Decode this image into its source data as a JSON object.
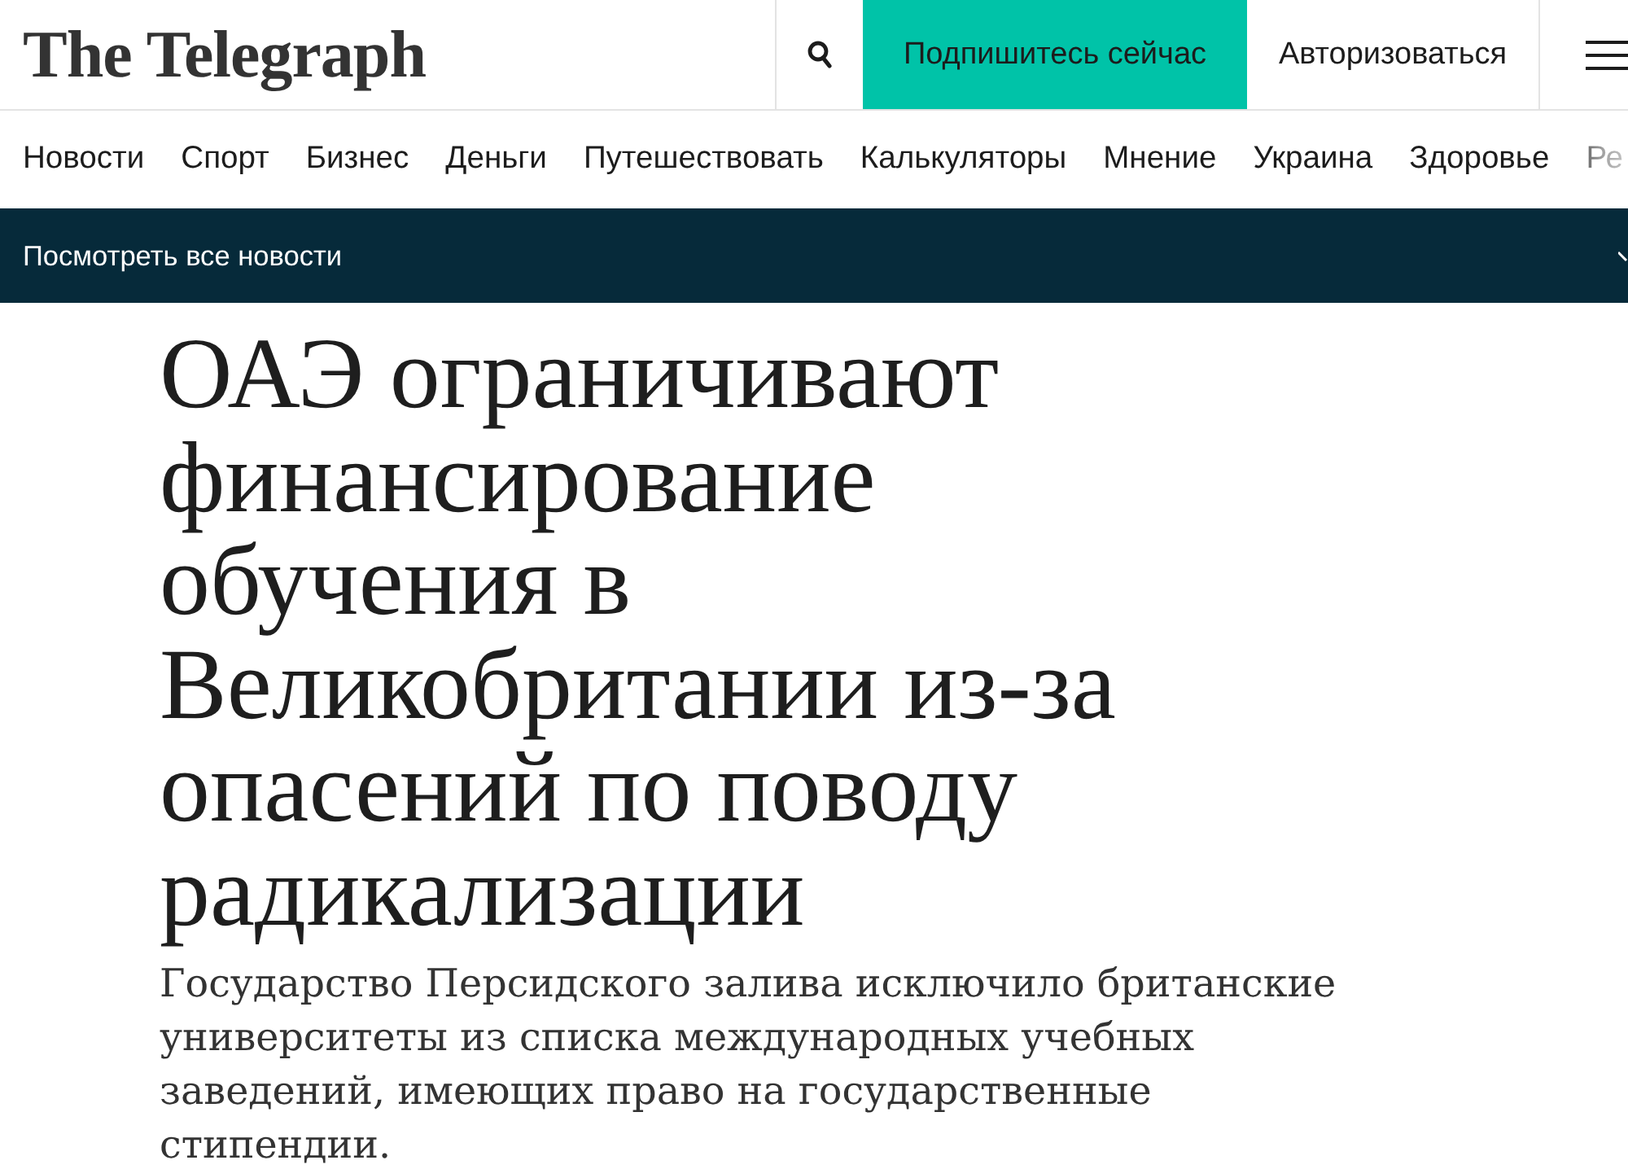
{
  "header": {
    "logo": "The Telegraph",
    "subscribe_button": "Подпишитесь сейчас",
    "login_button": "Авторизоваться"
  },
  "nav": {
    "items": [
      "Новости",
      "Спорт",
      "Бизнес",
      "Деньги",
      "Путешествовать",
      "Калькуляторы",
      "Мнение",
      "Украина",
      "Здоровье",
      "Ре"
    ]
  },
  "news_bar": {
    "label": "Посмотреть все новости"
  },
  "article": {
    "headline": "ОАЭ ограничивают финансирование обучения в Великобритании из-за опасений по поводу радикализации",
    "standfirst": "Государство Персидского залива исключило британские университеты из списка международных учебных заведений, имеющих право на государственные стипендии."
  }
}
